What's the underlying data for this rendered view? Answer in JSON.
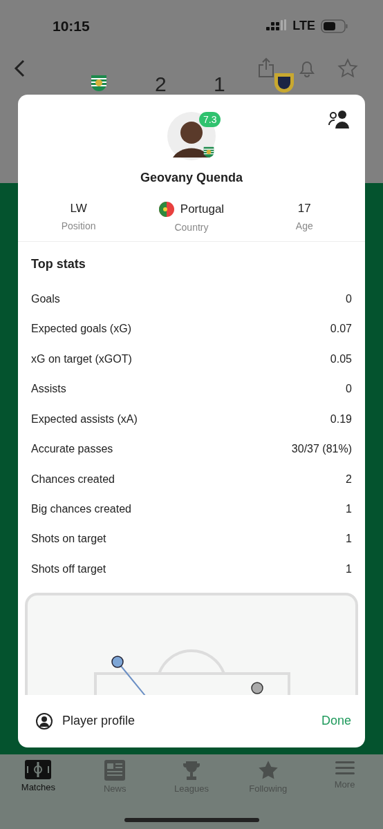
{
  "status_bar": {
    "time": "10:15",
    "network": "LTE"
  },
  "match": {
    "home_score": "2",
    "away_score": "1"
  },
  "player": {
    "rating": "7.3",
    "name": "Geovany Quenda",
    "info": [
      {
        "value": "LW",
        "label": "Position",
        "kind": "text"
      },
      {
        "value": "Portugal",
        "label": "Country",
        "kind": "flag"
      },
      {
        "value": "17",
        "label": "Age",
        "kind": "text"
      }
    ]
  },
  "top_stats": {
    "title": "Top stats",
    "rows": [
      {
        "label": "Goals",
        "value": "0"
      },
      {
        "label": "Expected goals (xG)",
        "value": "0.07"
      },
      {
        "label": "xG on target (xGOT)",
        "value": "0.05"
      },
      {
        "label": "Assists",
        "value": "0"
      },
      {
        "label": "Expected assists (xA)",
        "value": "0.19"
      },
      {
        "label": "Accurate passes",
        "value": "30/37 (81%)"
      },
      {
        "label": "Chances created",
        "value": "2"
      },
      {
        "label": "Big chances created",
        "value": "1"
      },
      {
        "label": "Shots on target",
        "value": "1"
      },
      {
        "label": "Shots off target",
        "value": "1"
      }
    ]
  },
  "footer": {
    "profile": "Player profile",
    "done": "Done"
  },
  "tab_bar": [
    {
      "label": "Matches",
      "kind": "matches",
      "selected": true
    },
    {
      "label": "News",
      "kind": "news",
      "selected": false
    },
    {
      "label": "Leagues",
      "kind": "leagues",
      "selected": false
    },
    {
      "label": "Following",
      "kind": "following",
      "selected": false
    },
    {
      "label": "More",
      "kind": "more",
      "selected": false
    }
  ]
}
